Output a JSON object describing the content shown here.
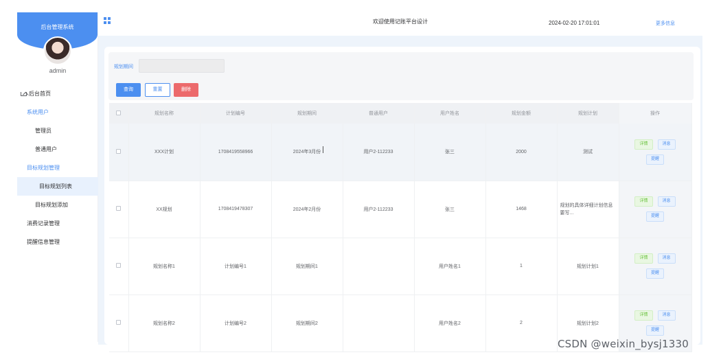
{
  "sidebar": {
    "brand": "后台管理系统",
    "user": "admin",
    "items": [
      {
        "label": "后台首页",
        "type": "home"
      },
      {
        "label": "系统用户",
        "type": "group"
      },
      {
        "label": "管理员",
        "type": "sub"
      },
      {
        "label": "普通用户",
        "type": "sub"
      },
      {
        "label": "目标规划管理",
        "type": "group"
      },
      {
        "label": "目标规划列表",
        "type": "active"
      },
      {
        "label": "目标规划添加",
        "type": "sub"
      },
      {
        "label": "消费记录管理",
        "type": "top"
      },
      {
        "label": "提醒信息管理",
        "type": "top"
      }
    ]
  },
  "header": {
    "title": "欢迎使用记账平台设计",
    "datetime": "2024-02-20 17:01:01",
    "more": "更多信息"
  },
  "search": {
    "label": "规划期间",
    "value": "",
    "query_btn": "查询",
    "reset_btn": "重置",
    "delete_btn": "删除"
  },
  "table": {
    "columns": [
      "规划名称",
      "计划编号",
      "规划期间",
      "普通用户",
      "用户姓名",
      "规划金额",
      "规划计划",
      "操作"
    ],
    "rows": [
      {
        "name": "XXX计划",
        "code": "1708419558966",
        "period": "2024年3月份",
        "user": "用户2-112233",
        "uname": "张三",
        "amount": "2000",
        "plan": "测试"
      },
      {
        "name": "XX规划",
        "code": "1708419478307",
        "period": "2024年2月份",
        "user": "用户2-112233",
        "uname": "张三",
        "amount": "1468",
        "plan": "规划的具体详细计划信息要写..."
      },
      {
        "name": "规划名称1",
        "code": "计划编号1",
        "period": "规划期间1",
        "user": "",
        "uname": "用户姓名1",
        "amount": "1",
        "plan": "规划计划1"
      },
      {
        "name": "规划名称2",
        "code": "计划编号2",
        "period": "规划期间2",
        "user": "",
        "uname": "用户姓名2",
        "amount": "2",
        "plan": "规划计划2"
      }
    ],
    "actions": {
      "detail": "详情",
      "message": "消息",
      "remind": "提醒"
    }
  },
  "watermark": "CSDN @weixin_bysj1330"
}
